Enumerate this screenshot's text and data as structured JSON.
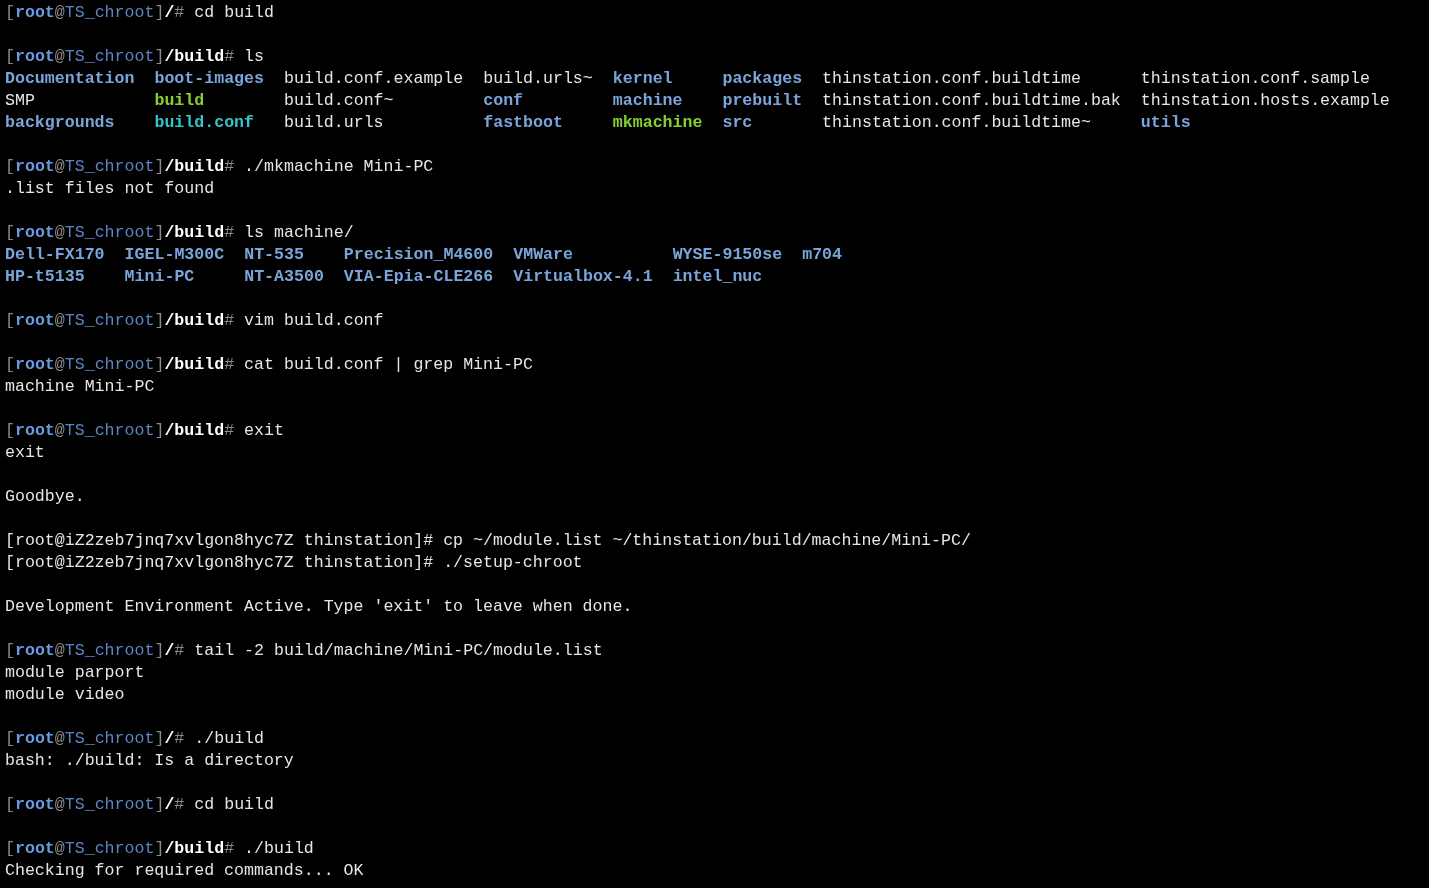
{
  "terminal": {
    "lines": [
      {
        "kind": "prompt",
        "prompt": [
          {
            "kind": "punct",
            "text": "["
          },
          {
            "kind": "user",
            "text": "root"
          },
          {
            "kind": "punct",
            "text": "@"
          },
          {
            "kind": "host",
            "text": "TS_chroot"
          },
          {
            "kind": "punct",
            "text": "]"
          },
          {
            "kind": "cwd",
            "text": "/"
          },
          {
            "kind": "punct",
            "text": "#"
          }
        ],
        "command": "cd build"
      },
      {
        "kind": "blank"
      },
      {
        "kind": "prompt",
        "prompt": [
          {
            "kind": "punct",
            "text": "["
          },
          {
            "kind": "user",
            "text": "root"
          },
          {
            "kind": "punct",
            "text": "@"
          },
          {
            "kind": "host",
            "text": "TS_chroot"
          },
          {
            "kind": "punct",
            "text": "]"
          },
          {
            "kind": "cwd",
            "text": "/build"
          },
          {
            "kind": "punct",
            "text": "#"
          }
        ],
        "command": "ls"
      },
      {
        "kind": "listing",
        "columns": [
          [
            {
              "name": "Documentation",
              "kind": "dir"
            },
            {
              "name": "SMP",
              "kind": "file"
            },
            {
              "name": "backgrounds",
              "kind": "dir"
            }
          ],
          [
            {
              "name": "boot-images",
              "kind": "dir"
            },
            {
              "name": "build",
              "kind": "exec"
            },
            {
              "name": "build.conf",
              "kind": "link"
            }
          ],
          [
            {
              "name": "build.conf.example",
              "kind": "file"
            },
            {
              "name": "build.conf~",
              "kind": "file"
            },
            {
              "name": "build.urls",
              "kind": "file"
            }
          ],
          [
            {
              "name": "build.urls~",
              "kind": "file"
            },
            {
              "name": "conf",
              "kind": "dir"
            },
            {
              "name": "fastboot",
              "kind": "dir"
            }
          ],
          [
            {
              "name": "kernel",
              "kind": "dir"
            },
            {
              "name": "machine",
              "kind": "dir"
            },
            {
              "name": "mkmachine",
              "kind": "exec"
            }
          ],
          [
            {
              "name": "packages",
              "kind": "dir"
            },
            {
              "name": "prebuilt",
              "kind": "dir"
            },
            {
              "name": "src",
              "kind": "dir"
            }
          ],
          [
            {
              "name": "thinstation.conf.buildtime",
              "kind": "file"
            },
            {
              "name": "thinstation.conf.buildtime.bak",
              "kind": "file"
            },
            {
              "name": "thinstation.conf.buildtime~",
              "kind": "file"
            }
          ],
          [
            {
              "name": "thinstation.conf.sample",
              "kind": "file"
            },
            {
              "name": "thinstation.hosts.example",
              "kind": "file"
            },
            {
              "name": "utils",
              "kind": "dir"
            }
          ]
        ]
      },
      {
        "kind": "blank"
      },
      {
        "kind": "prompt",
        "prompt": [
          {
            "kind": "punct",
            "text": "["
          },
          {
            "kind": "user",
            "text": "root"
          },
          {
            "kind": "punct",
            "text": "@"
          },
          {
            "kind": "host",
            "text": "TS_chroot"
          },
          {
            "kind": "punct",
            "text": "]"
          },
          {
            "kind": "cwd",
            "text": "/build"
          },
          {
            "kind": "punct",
            "text": "#"
          }
        ],
        "command": "./mkmachine Mini-PC"
      },
      {
        "kind": "output",
        "text": ".list files not found"
      },
      {
        "kind": "blank"
      },
      {
        "kind": "prompt",
        "prompt": [
          {
            "kind": "punct",
            "text": "["
          },
          {
            "kind": "user",
            "text": "root"
          },
          {
            "kind": "punct",
            "text": "@"
          },
          {
            "kind": "host",
            "text": "TS_chroot"
          },
          {
            "kind": "punct",
            "text": "]"
          },
          {
            "kind": "cwd",
            "text": "/build"
          },
          {
            "kind": "punct",
            "text": "#"
          }
        ],
        "command": "ls machine/"
      },
      {
        "kind": "listing",
        "columns": [
          [
            {
              "name": "Dell-FX170",
              "kind": "dir"
            },
            {
              "name": "HP-t5135",
              "kind": "dir"
            }
          ],
          [
            {
              "name": "IGEL-M300C",
              "kind": "dir"
            },
            {
              "name": "Mini-PC",
              "kind": "dir"
            }
          ],
          [
            {
              "name": "NT-535",
              "kind": "dir"
            },
            {
              "name": "NT-A3500",
              "kind": "dir"
            }
          ],
          [
            {
              "name": "Precision_M4600",
              "kind": "dir"
            },
            {
              "name": "VIA-Epia-CLE266",
              "kind": "dir"
            }
          ],
          [
            {
              "name": "VMWare",
              "kind": "dir"
            },
            {
              "name": "Virtualbox-4.1",
              "kind": "dir"
            }
          ],
          [
            {
              "name": "WYSE-9150se",
              "kind": "dir"
            },
            {
              "name": "intel_nuc",
              "kind": "dir"
            }
          ],
          [
            {
              "name": "m704",
              "kind": "dir"
            }
          ]
        ]
      },
      {
        "kind": "blank"
      },
      {
        "kind": "prompt",
        "prompt": [
          {
            "kind": "punct",
            "text": "["
          },
          {
            "kind": "user",
            "text": "root"
          },
          {
            "kind": "punct",
            "text": "@"
          },
          {
            "kind": "host",
            "text": "TS_chroot"
          },
          {
            "kind": "punct",
            "text": "]"
          },
          {
            "kind": "cwd",
            "text": "/build"
          },
          {
            "kind": "punct",
            "text": "#"
          }
        ],
        "command": "vim build.conf"
      },
      {
        "kind": "blank"
      },
      {
        "kind": "prompt",
        "prompt": [
          {
            "kind": "punct",
            "text": "["
          },
          {
            "kind": "user",
            "text": "root"
          },
          {
            "kind": "punct",
            "text": "@"
          },
          {
            "kind": "host",
            "text": "TS_chroot"
          },
          {
            "kind": "punct",
            "text": "]"
          },
          {
            "kind": "cwd",
            "text": "/build"
          },
          {
            "kind": "punct",
            "text": "#"
          }
        ],
        "command": "cat build.conf | grep Mini-PC"
      },
      {
        "kind": "output",
        "text": "machine Mini-PC"
      },
      {
        "kind": "blank"
      },
      {
        "kind": "prompt",
        "prompt": [
          {
            "kind": "punct",
            "text": "["
          },
          {
            "kind": "user",
            "text": "root"
          },
          {
            "kind": "punct",
            "text": "@"
          },
          {
            "kind": "host",
            "text": "TS_chroot"
          },
          {
            "kind": "punct",
            "text": "]"
          },
          {
            "kind": "cwd",
            "text": "/build"
          },
          {
            "kind": "punct",
            "text": "#"
          }
        ],
        "command": "exit"
      },
      {
        "kind": "output",
        "text": "exit"
      },
      {
        "kind": "blank"
      },
      {
        "kind": "output",
        "text": "Goodbye."
      },
      {
        "kind": "blank"
      },
      {
        "kind": "output",
        "text": "[root@iZ2zeb7jnq7xvlgon8hyc7Z thinstation]# cp ~/module.list ~/thinstation/build/machine/Mini-PC/"
      },
      {
        "kind": "output",
        "text": "[root@iZ2zeb7jnq7xvlgon8hyc7Z thinstation]# ./setup-chroot"
      },
      {
        "kind": "blank"
      },
      {
        "kind": "output",
        "text": "Development Environment Active. Type 'exit' to leave when done."
      },
      {
        "kind": "blank"
      },
      {
        "kind": "prompt",
        "prompt": [
          {
            "kind": "punct",
            "text": "["
          },
          {
            "kind": "user",
            "text": "root"
          },
          {
            "kind": "punct",
            "text": "@"
          },
          {
            "kind": "host",
            "text": "TS_chroot"
          },
          {
            "kind": "punct",
            "text": "]"
          },
          {
            "kind": "cwd",
            "text": "/"
          },
          {
            "kind": "punct",
            "text": "#"
          }
        ],
        "command": "tail -2 build/machine/Mini-PC/module.list"
      },
      {
        "kind": "output",
        "text": "module parport"
      },
      {
        "kind": "output",
        "text": "module video"
      },
      {
        "kind": "blank"
      },
      {
        "kind": "prompt",
        "prompt": [
          {
            "kind": "punct",
            "text": "["
          },
          {
            "kind": "user",
            "text": "root"
          },
          {
            "kind": "punct",
            "text": "@"
          },
          {
            "kind": "host",
            "text": "TS_chroot"
          },
          {
            "kind": "punct",
            "text": "]"
          },
          {
            "kind": "cwd",
            "text": "/"
          },
          {
            "kind": "punct",
            "text": "#"
          }
        ],
        "command": "./build"
      },
      {
        "kind": "output",
        "text": "bash: ./build: Is a directory"
      },
      {
        "kind": "blank"
      },
      {
        "kind": "prompt",
        "prompt": [
          {
            "kind": "punct",
            "text": "["
          },
          {
            "kind": "user",
            "text": "root"
          },
          {
            "kind": "punct",
            "text": "@"
          },
          {
            "kind": "host",
            "text": "TS_chroot"
          },
          {
            "kind": "punct",
            "text": "]"
          },
          {
            "kind": "cwd",
            "text": "/"
          },
          {
            "kind": "punct",
            "text": "#"
          }
        ],
        "command": "cd build"
      },
      {
        "kind": "blank"
      },
      {
        "kind": "prompt",
        "prompt": [
          {
            "kind": "punct",
            "text": "["
          },
          {
            "kind": "user",
            "text": "root"
          },
          {
            "kind": "punct",
            "text": "@"
          },
          {
            "kind": "host",
            "text": "TS_chroot"
          },
          {
            "kind": "punct",
            "text": "]"
          },
          {
            "kind": "cwd",
            "text": "/build"
          },
          {
            "kind": "punct",
            "text": "#"
          }
        ],
        "command": "./build"
      },
      {
        "kind": "output",
        "text": "Checking for required commands... OK"
      }
    ]
  }
}
